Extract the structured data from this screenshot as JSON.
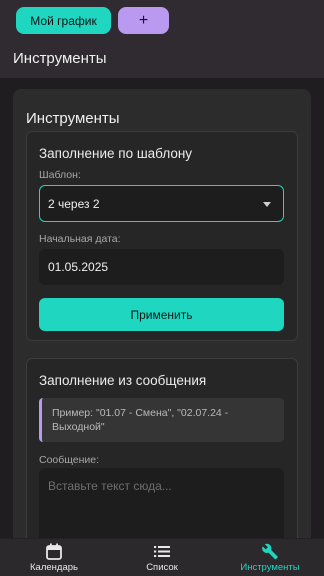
{
  "header": {
    "schedule_button": "Мой график",
    "add_button": "+",
    "page_title": "Инструменты"
  },
  "panel": {
    "title": "Инструменты"
  },
  "template_card": {
    "title": "Заполнение по шаблону",
    "template_label": "Шаблон:",
    "template_value": "2 через 2",
    "start_date_label": "Начальная дата:",
    "start_date_value": "01.05.2025",
    "apply_button": "Применить"
  },
  "message_card": {
    "title": "Заполнение из сообщения",
    "hint": "Пример: \"01.07 - Смена\", \"02.07.24 - Выходной\"",
    "message_label": "Сообщение:",
    "message_placeholder": "Вставьте текст сюда..."
  },
  "bottom_nav": {
    "items": [
      {
        "label": "Календарь",
        "icon": "calendar-icon",
        "active": false
      },
      {
        "label": "Список",
        "icon": "list-icon",
        "active": false
      },
      {
        "label": "Инструменты",
        "icon": "wrench-icon",
        "active": true
      }
    ]
  },
  "colors": {
    "accent": "#1fd6c0",
    "secondary": "#b99af0",
    "background": "#1f1d20"
  }
}
